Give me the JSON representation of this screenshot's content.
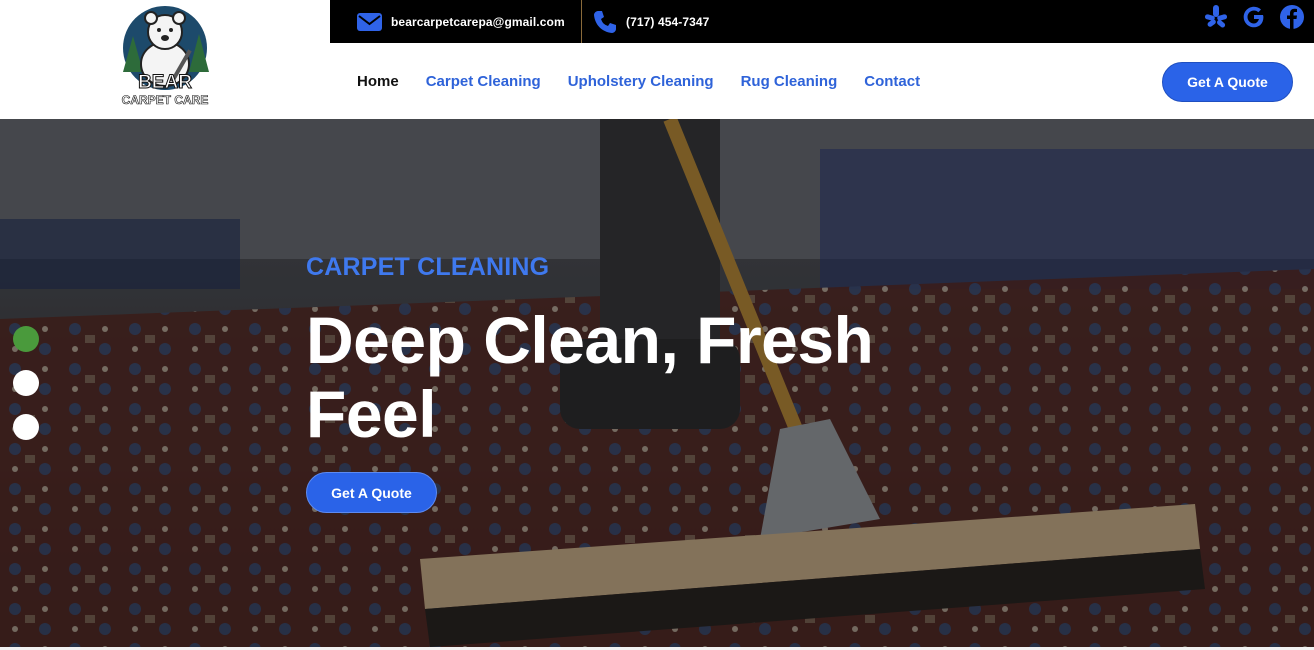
{
  "brand": {
    "logo_line1": "BEAR",
    "logo_line2": "CARPET CARE"
  },
  "topbar": {
    "email": "bearcarpetcarepa@gmail.com",
    "phone": "(717) 454-7347",
    "social": [
      "yelp-icon",
      "google-icon",
      "facebook-icon"
    ]
  },
  "nav": {
    "items": [
      {
        "label": "Home",
        "active": true
      },
      {
        "label": "Carpet Cleaning",
        "active": false
      },
      {
        "label": "Upholstery Cleaning",
        "active": false
      },
      {
        "label": "Rug Cleaning",
        "active": false
      },
      {
        "label": "Contact",
        "active": false
      }
    ],
    "cta": "Get A Quote"
  },
  "hero": {
    "eyebrow": "CARPET CLEANING",
    "headline": "Deep Clean, Fresh Feel",
    "cta": "Get A Quote",
    "slides": 3,
    "active_slide": 1
  },
  "colors": {
    "accent": "#2a63e8",
    "eyebrow": "#3f79ee",
    "topbar": "#000000",
    "active_dot": "#4a9a3c"
  }
}
